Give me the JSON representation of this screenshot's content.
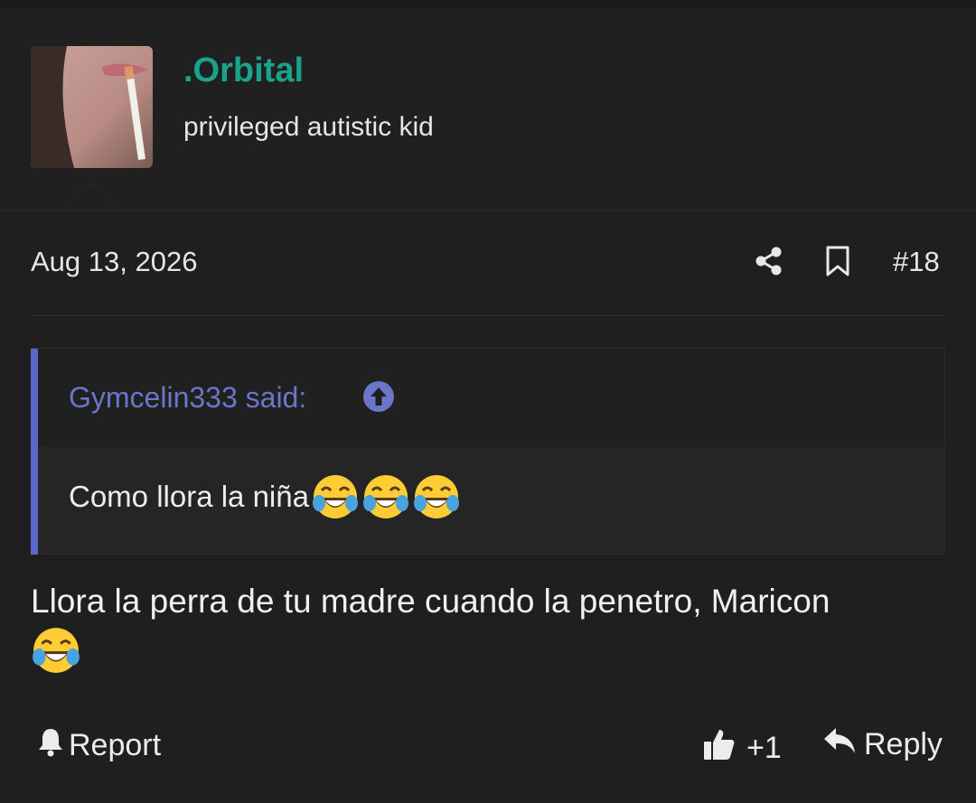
{
  "author": {
    "name": ".Orbital",
    "title": "privileged autistic kid",
    "name_color": "#19a38a"
  },
  "post": {
    "date": "Aug 13, 2026",
    "number": "#18",
    "quote": {
      "author_line": "Gymcelin333 said:",
      "text": "Como llora la niña",
      "emoji_count": 3,
      "accent_color": "#5a68c8"
    },
    "message": "Llora la perra de tu madre cuando la penetro, Maricon",
    "message_emoji": "face-with-tears-of-joy"
  },
  "actions": {
    "report_label": "Report",
    "like_label": "+1",
    "reply_label": "Reply"
  },
  "icons": [
    "share-icon",
    "bookmark-icon",
    "arrow-up-circle-icon",
    "bell-icon",
    "thumbs-up-icon",
    "reply-icon"
  ]
}
